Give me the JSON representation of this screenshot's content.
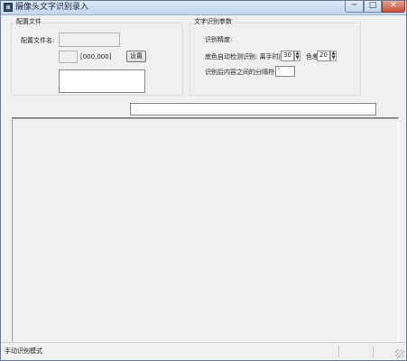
{
  "window": {
    "title": "摄像头文字识别录入",
    "minimize_label": "─",
    "maximize_label": "□",
    "close_label": "✕"
  },
  "config_group": {
    "title": "配置文件",
    "filename_label": "配置文件名:",
    "filename_value": "",
    "coords_text": "[000,000]",
    "settings_button": "设置",
    "preview_text": ""
  },
  "ocr_group": {
    "title": "文字识别参数",
    "precision_label": "识别精度:",
    "auto_detect_label": "底色自动检测识别: 离手时间",
    "hand_off_time": "30",
    "color_diff_label": "色差",
    "color_diff": "20",
    "separator_label": "识别后内容之间的分隔符:",
    "separator_value": "'"
  },
  "top_input": {
    "value": ""
  },
  "status": {
    "mode": "手动识别模式"
  }
}
